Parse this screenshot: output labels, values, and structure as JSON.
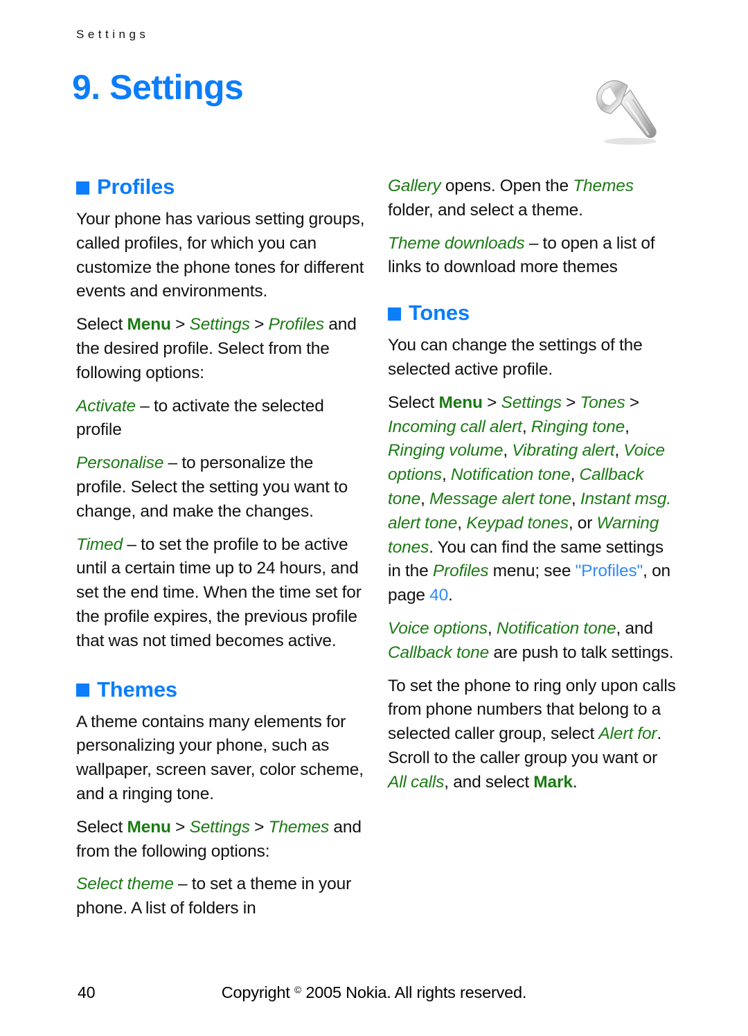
{
  "header": {
    "running_head": "Settings"
  },
  "chapter": {
    "title": "9. Settings",
    "icon": "wrench-icon"
  },
  "colors": {
    "heading_blue": "#0C7DFB",
    "ui_green": "#1B7A14",
    "xref_blue": "#2E8BF5",
    "body_black": "#111111"
  },
  "left_column": {
    "profiles_section": {
      "heading": "Profiles",
      "paragraphs": {
        "intro": "Your phone has various setting groups, called profiles, for which you can customize the phone tones for different events and environments.",
        "select_lead": "Select ",
        "select_menu": "Menu",
        "sep1": " > ",
        "select_settings": "Settings",
        "sep2": " > ",
        "select_profiles": "Profiles",
        "select_tail": " and the desired profile. Select from the following options:",
        "activate_term": "Activate",
        "activate_desc": " – to activate the selected profile",
        "personalise_term": "Personalise",
        "personalise_desc": " – to personalize the profile. Select the setting you want to change, and make the changes.",
        "timed_term": "Timed",
        "timed_desc": " – to set the profile to be active until a certain time up to 24 hours, and set the end time. When the time set for the profile expires, the previous profile that was not timed becomes active."
      }
    },
    "themes_section": {
      "heading": "Themes",
      "paragraphs": {
        "intro": "A theme contains many elements for personalizing your phone, such as wallpaper, screen saver, color scheme, and a ringing tone.",
        "select_lead": "Select ",
        "select_menu": "Menu",
        "sep1": " > ",
        "select_settings": "Settings",
        "sep2": " > ",
        "select_themes": "Themes",
        "select_tail": " and from the following options:",
        "select_theme_term": "Select theme",
        "select_theme_desc": " – to set a theme in your phone. A list of folders in"
      }
    }
  },
  "right_column": {
    "themes_continued": {
      "gallery_term": "Gallery",
      "gallery_desc": " opens. Open the ",
      "gallery_themes": "Themes",
      "gallery_tail": " folder, and select a theme.",
      "downloads_term": "Theme downloads",
      "downloads_desc": " – to open a list of links to download more themes"
    },
    "tones_section": {
      "heading": "Tones",
      "intro": "You can change the settings of the selected active profile.",
      "select_lead": "Select ",
      "select_menu": "Menu",
      "sep1": " > ",
      "select_settings": "Settings",
      "sep2": " > ",
      "select_tones": "Tones",
      "sep3": " > ",
      "tone_items": [
        "Incoming call alert",
        "Ringing tone",
        "Ringing volume",
        "Vibrating alert",
        "Voice options",
        "Notification tone",
        "Callback tone",
        "Message alert tone",
        "Instant msg. alert tone",
        "Keypad tones",
        "Warning tones"
      ],
      "tone_list_rendered_a": "Incoming call alert",
      "tone_list_rendered_b": "Ringing tone",
      "tone_list_rendered_c": "Ringing volume",
      "tone_list_rendered_d": "Vibrating alert",
      "tone_list_rendered_e": "Voice options",
      "tone_list_rendered_f": "Notification tone",
      "tone_list_rendered_g": "Callback tone",
      "tone_list_rendered_h": "Message alert tone",
      "tone_list_rendered_i": "Instant msg. alert tone",
      "tone_list_rendered_j": "Keypad tones",
      "tone_list_or": ", or ",
      "tone_list_k": "Warning tones",
      "after_list": ". You can find the same settings in the ",
      "profiles_italic": "Profiles",
      "menu_see": " menu; see ",
      "xref_label": "\"Profiles\"",
      "xref_mid": ", on page ",
      "xref_page": "40",
      "xref_end": ".",
      "ptt_a": "Voice options",
      "ptt_b": "Notification tone",
      "ptt_mid": ", and ",
      "ptt_c": "Callback tone",
      "ptt_tail": " are push to talk settings.",
      "alert_lead": "To set the phone to ring only upon calls from phone numbers that belong to a selected caller group, select ",
      "alert_for": "Alert for",
      "alert_mid": ". Scroll to the caller group you want or ",
      "all_calls": "All calls",
      "alert_tail2": ", and select ",
      "mark": "Mark",
      "alert_period": "."
    }
  },
  "footer": {
    "page_number": "40",
    "copyright_pre": "Copyright ",
    "copyright_symbol": "©",
    "copyright_post": " 2005 Nokia. All rights reserved."
  }
}
